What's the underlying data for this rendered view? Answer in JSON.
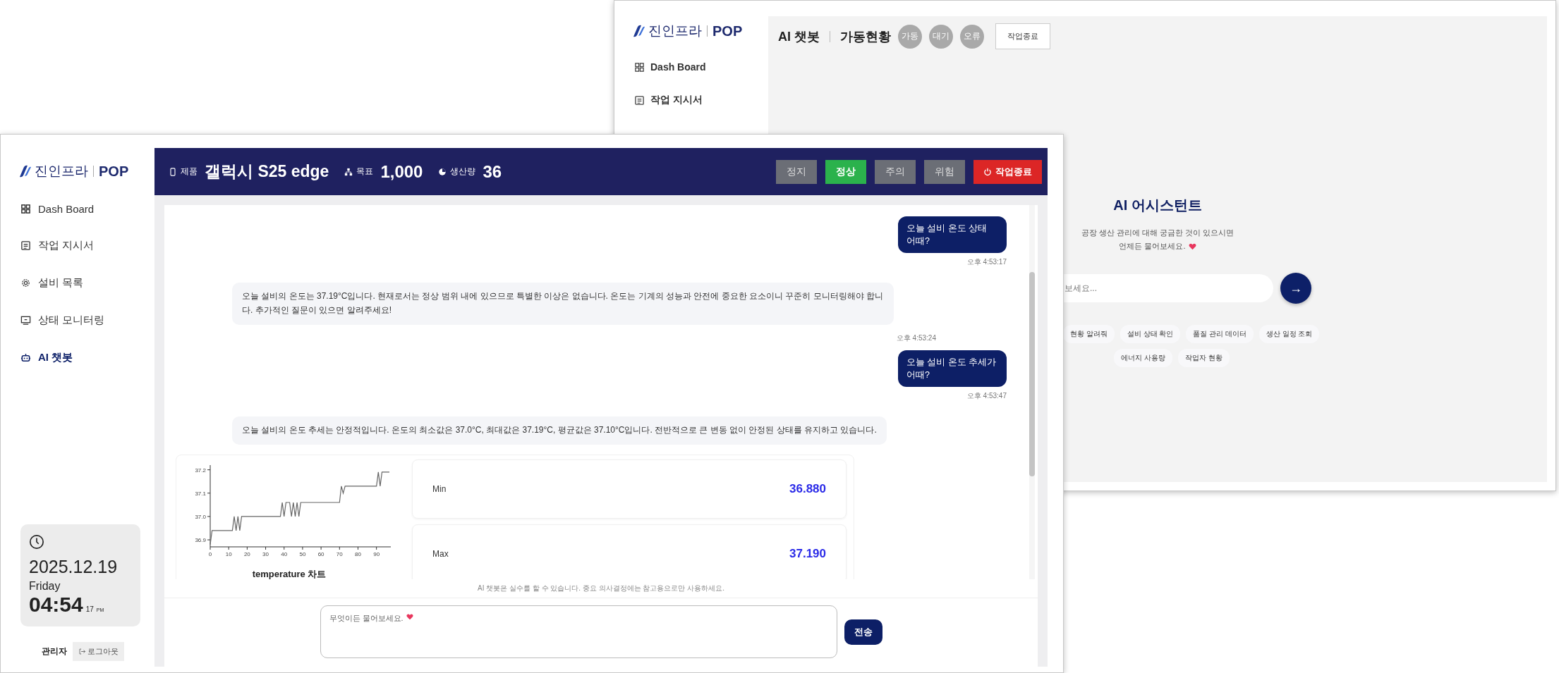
{
  "back_window": {
    "logo": {
      "brand": "진인프라",
      "product": "POP"
    },
    "sidebar": {
      "items": [
        {
          "label": "Dash Board"
        },
        {
          "label": "작업 지시서"
        }
      ]
    },
    "header": {
      "title": "AI 챗봇",
      "subtitle": "가동현황",
      "status_lights": [
        {
          "label": "가동",
          "on": false
        },
        {
          "label": "대기",
          "on": false
        },
        {
          "label": "오류",
          "on": false
        }
      ],
      "end_button": "작업종료"
    },
    "assistant": {
      "title": "AI 어시스턴트",
      "description_lines": [
        "공장 생산 관리에 대해 궁금한 것이 있으시면",
        "언제든 물어보세요."
      ],
      "input": {
        "placeholder": "보세요..."
      },
      "send_button": "→",
      "suggestion_rows": [
        [
          "현황 알려줘",
          "설비 상태 확인",
          "품질 관리 데이터",
          "생산 일정 조회"
        ],
        [
          "에너지 사용량",
          "작업자 현황"
        ]
      ]
    }
  },
  "front_window": {
    "logo": {
      "brand": "진인프라",
      "product": "POP"
    },
    "sidebar": {
      "items": [
        {
          "label": "Dash Board",
          "selected": false
        },
        {
          "label": "작업 지시서",
          "selected": false
        },
        {
          "label": "설비 목록",
          "selected": false
        },
        {
          "label": "상태 모니터링",
          "selected": false
        },
        {
          "label": "AI 챗봇",
          "selected": true
        }
      ]
    },
    "clock": {
      "date": "2025.12.19",
      "weekday": "Friday",
      "time": "04:54",
      "seconds": "17",
      "meridiem": "PM"
    },
    "user": {
      "name": "관리자",
      "logout_button": "로그아웃"
    },
    "header": {
      "product": {
        "label": "제품",
        "value": "갤럭시 S25 edge"
      },
      "target": {
        "label": "목표",
        "value": "1,000"
      },
      "output": {
        "label": "생산량",
        "value": "36"
      },
      "status_buttons": [
        {
          "label": "정지",
          "selected": false
        },
        {
          "label": "정상",
          "selected": true
        },
        {
          "label": "주의",
          "selected": false
        },
        {
          "label": "위험",
          "selected": false
        }
      ],
      "end_button": "작업종료"
    },
    "chat": {
      "messages": [
        {
          "kind": "user",
          "text": "오늘 설비 온도 상태 어때?",
          "time": "오후 4:53:17"
        },
        {
          "kind": "bot",
          "text": "오늘 설비의 온도는 37.19°C입니다. 현재로서는 정상 범위 내에 있으므로 특별한 이상은 없습니다. 온도는 기계의 성능과 안전에 중요한 요소이니 꾸준히 모니터링해야 합니다. 추가적인 질문이 있으면 알려주세요!",
          "time": "오후 4:53:24"
        },
        {
          "kind": "user",
          "text": "오늘 설비 온도 추세가 어때?",
          "time": "오후 4:53:47"
        },
        {
          "kind": "bot",
          "text": "오늘 설비의 온도 추세는 안정적입니다. 온도의 최소값은 37.0°C, 최대값은 37.19°C, 평균값은 37.10°C입니다. 전반적으로 큰 변동 없이 안정된 상태를 유지하고 있습니다.",
          "chart_data": {
            "type": "line",
            "title": "temperature 차트",
            "x": [
              0,
              1,
              12,
              13,
              14,
              15,
              16,
              17,
              38,
              39,
              40,
              41,
              43,
              44,
              45,
              46,
              47,
              48,
              49,
              70,
              71,
              72,
              73,
              90,
              91,
              92,
              93,
              97
            ],
            "series": [
              {
                "color": "#666666",
                "values": [
                  36.88,
                  36.94,
                  36.94,
                  37.0,
                  36.94,
                  37.0,
                  36.94,
                  37.0,
                  37.0,
                  37.06,
                  37.0,
                  37.06,
                  37.06,
                  37.0,
                  37.06,
                  37.0,
                  37.06,
                  37.0,
                  37.06,
                  37.06,
                  37.13,
                  37.1,
                  37.13,
                  37.13,
                  37.19,
                  37.13,
                  37.19,
                  37.19
                ]
              }
            ],
            "xlim": [
              0,
              97
            ],
            "ylim": [
              36.87,
              37.22
            ],
            "xticks": [
              0,
              10,
              20,
              30,
              40,
              50,
              60,
              70,
              80,
              90
            ],
            "yticks": [
              {
                "value": 36.9,
                "label": "36.9"
              },
              {
                "value": 37.0,
                "label": "37.0"
              },
              {
                "value": 37.1,
                "label": "37.1"
              },
              {
                "value": 37.2,
                "label": "37.2"
              }
            ]
          },
          "stats": [
            {
              "label": "Min",
              "value": "36.880"
            },
            {
              "label": "Max",
              "value": "37.190"
            }
          ]
        }
      ],
      "disclaimer": "AI 챗봇은 실수를 할 수 있습니다. 중요 의사결정에는 참고용으로만 사용하세요.",
      "input": {
        "placeholder": "무엇이든 물어보세요."
      },
      "send_button": "전송"
    }
  }
}
